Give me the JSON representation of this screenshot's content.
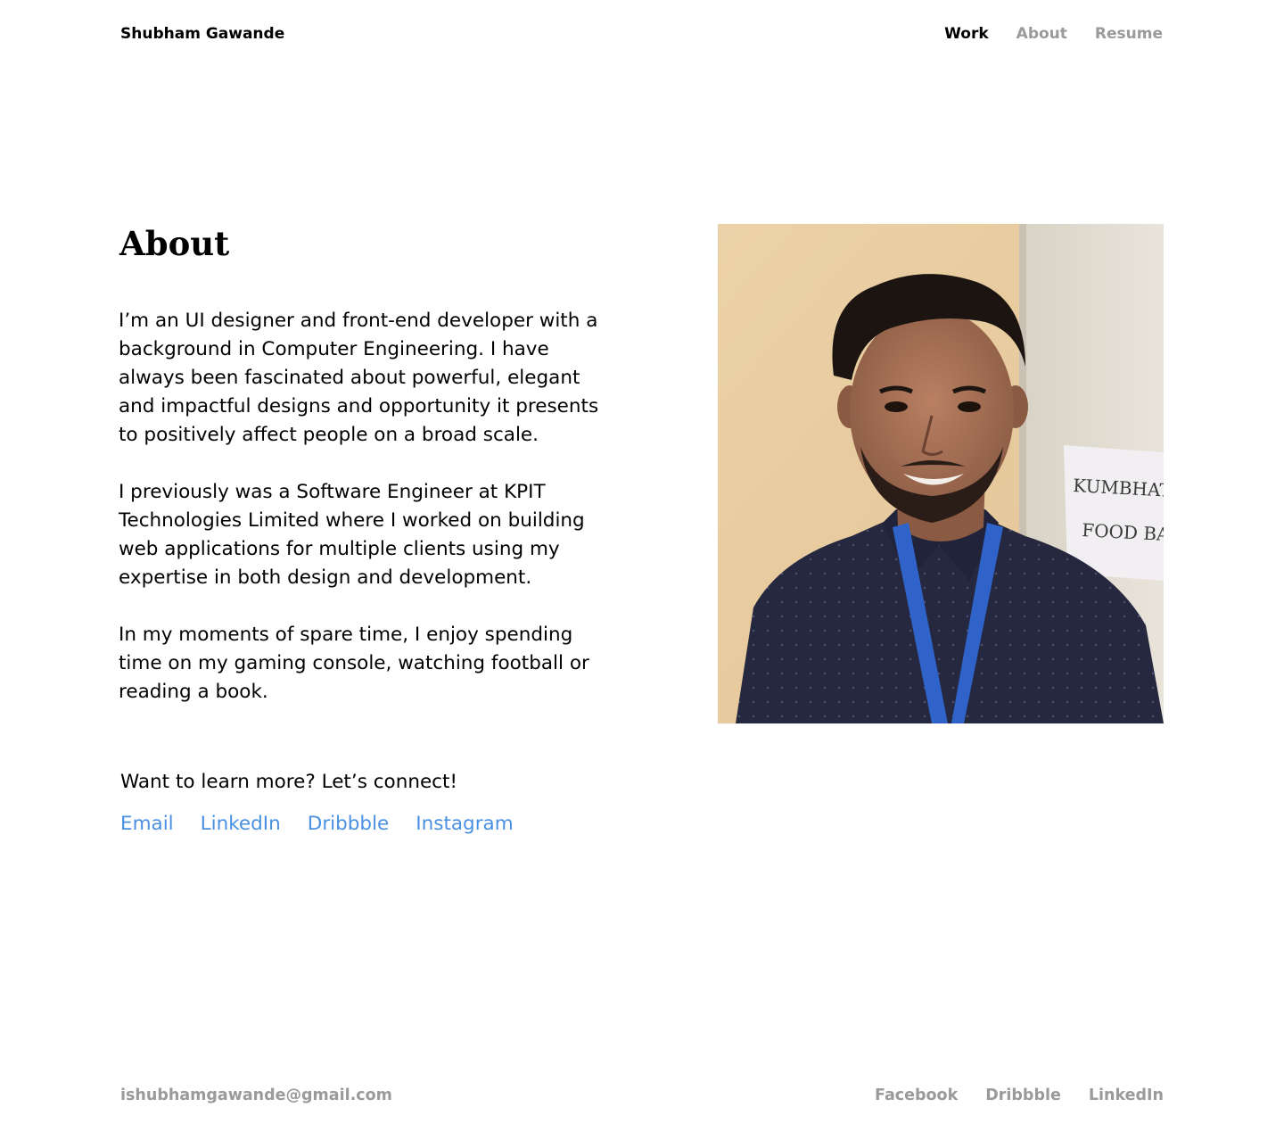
{
  "header": {
    "brand": "Shubham Gawande",
    "nav": {
      "work": "Work",
      "about": "About",
      "resume": "Resume"
    }
  },
  "main": {
    "title": "About",
    "paragraphs": [
      "I’m an UI designer and front-end developer with a background in Computer Engineering. I have always been fascinated about powerful, elegant and impactful designs and opportunity it presents to positively affect people on a broad scale.",
      "I previously was a Software Engineer at KPIT Technologies Limited where I worked on building web applications for multiple clients using my expertise in both design and development.",
      "In my moments of spare time, I enjoy spending time on my gaming console, watching football or reading a book."
    ],
    "connect_text": "Want to learn more? Let’s connect!",
    "connect_links": {
      "email": "Email",
      "linkedin": "LinkedIn",
      "dribbble": "Dribbble",
      "instagram": "Instagram"
    },
    "portrait": {
      "sign_line1": "KUMBHATHON",
      "sign_line2": "FOOD BAY"
    }
  },
  "footer": {
    "email": "ishubhamgawande@gmail.com",
    "links": {
      "facebook": "Facebook",
      "dribbble": "Dribbble",
      "linkedin": "LinkedIn"
    }
  },
  "colors": {
    "link_blue": "#4a90e2",
    "muted_gray": "#9a9a9a",
    "text": "#000000",
    "background": "#ffffff"
  }
}
